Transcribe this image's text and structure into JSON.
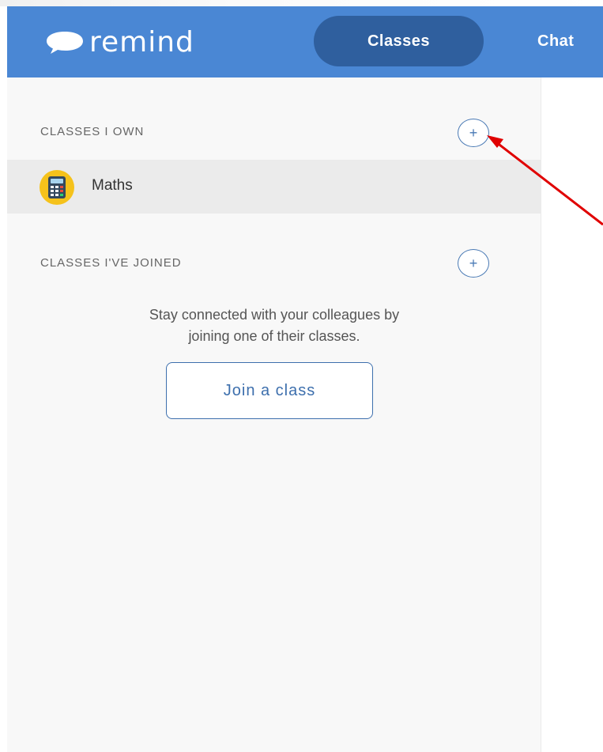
{
  "header": {
    "logo_text": "remind",
    "tabs": [
      {
        "label": "Classes",
        "active": true
      },
      {
        "label": "Chat",
        "active": false
      }
    ]
  },
  "sidebar": {
    "owned": {
      "title": "CLASSES I OWN",
      "add_label": "+",
      "classes": [
        {
          "name": "Maths",
          "icon": "calculator-icon"
        }
      ]
    },
    "joined": {
      "title": "CLASSES I'VE JOINED",
      "add_label": "+",
      "empty_line_1": "Stay connected with your colleagues by",
      "empty_line_2": "joining one of their classes.",
      "join_button": "Join a class"
    }
  },
  "colors": {
    "header_bg": "#4a87d4",
    "active_tab_bg": "#2f5f9e",
    "sidebar_bg": "#f8f8f8",
    "selected_row_bg": "#ebebeb",
    "accent": "#3d6fad",
    "class_avatar_bg": "#f5c21b",
    "annotation_arrow": "#e00000"
  }
}
